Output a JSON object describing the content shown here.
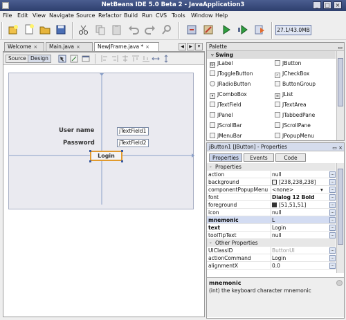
{
  "window": {
    "title": "NetBeans IDE 5.0 Beta 2 - JavaApplication3",
    "minimize": "_",
    "maximize": "□",
    "close": "×"
  },
  "menu": [
    "File",
    "Edit",
    "View",
    "Navigate",
    "Source",
    "Refactor",
    "Build",
    "Run",
    "CVS",
    "Tools",
    "Window",
    "Help"
  ],
  "toolbar": {
    "icons": [
      "new-project-icon",
      "new-file-icon",
      "open-project-icon",
      "save-all-icon",
      "cut-icon",
      "copy-icon",
      "paste-icon",
      "undo-icon",
      "redo-icon",
      "find-icon",
      "build-main-icon",
      "clean-build-icon",
      "run-main-icon",
      "debug-main-icon",
      "profile-icon"
    ],
    "memory": "27.1/43.0MB"
  },
  "editor": {
    "tabs": [
      {
        "label": "Welcome",
        "close": "×"
      },
      {
        "label": "Main.java",
        "close": "×"
      },
      {
        "label": "NewJFrame.java *",
        "close": "×"
      }
    ],
    "nav": [
      "◀",
      "▶",
      "▾"
    ],
    "modes": [
      "Source",
      "Design"
    ],
    "form": {
      "username_label": "User name",
      "password_label": "Password",
      "field1": "jTextField1",
      "field2": "jTextField2",
      "login_button": "Login"
    }
  },
  "palette": {
    "title": "Palette",
    "category": "Swing",
    "items": [
      [
        "JLabel",
        "JButton"
      ],
      [
        "JToggleButton",
        "JCheckBox"
      ],
      [
        "JRadioButton",
        "ButtonGroup"
      ],
      [
        "JComboBox",
        "JList"
      ],
      [
        "JTextField",
        "JTextArea"
      ],
      [
        "JPanel",
        "JTabbedPane"
      ],
      [
        "JScrollBar",
        "JScrollPane"
      ],
      [
        "JMenuBar",
        "JPopupMenu"
      ]
    ]
  },
  "properties": {
    "title": "jButton1 [JButton] - Properties",
    "tabs": [
      "Properties",
      "Events",
      "Code"
    ],
    "section1": "Properties",
    "rows": [
      {
        "name": "action",
        "value": "null",
        "bold": false
      },
      {
        "name": "background",
        "value": "[238,238,238]",
        "bold": false,
        "swatch": "#eeeeee"
      },
      {
        "name": "componentPopupMenu",
        "value": "<none>",
        "bold": false,
        "combo": "▾"
      },
      {
        "name": "font",
        "value": "Dialog 12 Bold",
        "bold": false,
        "boldval": true
      },
      {
        "name": "foreground",
        "value": "[51,51,51]",
        "bold": false,
        "swatch": "#333333"
      },
      {
        "name": "icon",
        "value": "null",
        "bold": false
      },
      {
        "name": "mnemonic",
        "value": "L",
        "bold": true,
        "selected": true
      },
      {
        "name": "text",
        "value": "Login",
        "bold": true
      },
      {
        "name": "toolTipText",
        "value": "null",
        "bold": false
      }
    ],
    "section2": "Other Properties",
    "rows2": [
      {
        "name": "UIClassID",
        "value": "ButtonUI",
        "grey": true
      },
      {
        "name": "actionCommand",
        "value": "Login"
      },
      {
        "name": "alignmentX",
        "value": "0.0"
      }
    ],
    "desc_title": "mnemonic",
    "desc_text": "(int)  the keyboard character mnemonic"
  },
  "colors": {
    "accent": "#c9d3ea",
    "selection": "#d3dcf2",
    "title": "#34477a"
  }
}
